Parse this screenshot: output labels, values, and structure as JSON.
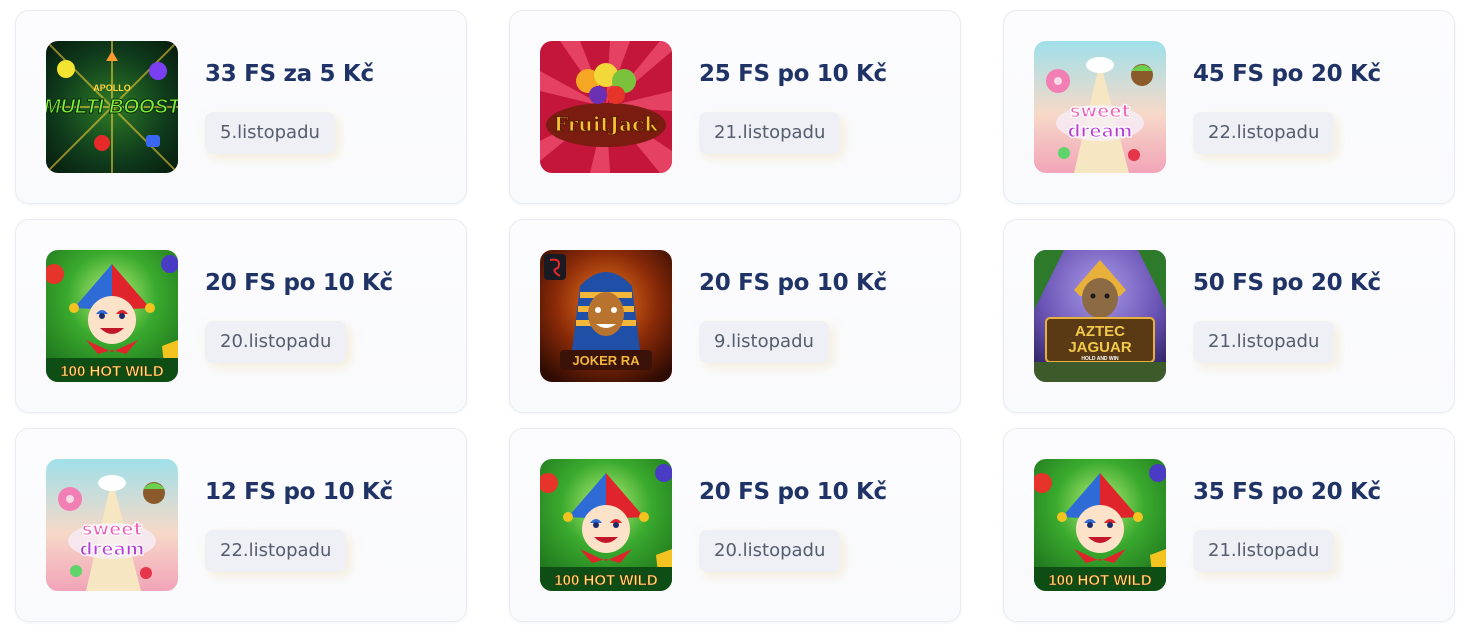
{
  "bonuses": [
    {
      "game": "multiboost",
      "offer": "33 FS za 5 Kč",
      "date": "5.listopadu",
      "logo_text": "MULTI BOOST",
      "logo_top": "APOLLO",
      "colors": {
        "bg": "#0f3b1c",
        "accent": "#7ff23a"
      }
    },
    {
      "game": "fruitjack",
      "offer": "25 FS po 10 Kč",
      "date": "21.listopadu",
      "logo_text": "FruitJack",
      "colors": {
        "bg": "#d92746",
        "accent": "#f5c531"
      }
    },
    {
      "game": "sweetdream",
      "offer": "45 FS po 20 Kč",
      "date": "22.listopadu",
      "logo_text": "sweet dream",
      "colors": {
        "bg": "#f4c6cf",
        "accent": "#e24fb8"
      }
    },
    {
      "game": "100hotwild",
      "offer": "20 FS po 10 Kč",
      "date": "20.listopadu",
      "logo_text": "100 HOT WILD",
      "colors": {
        "bg": "#2f9b2c",
        "accent": "#d8232b"
      }
    },
    {
      "game": "jokerra",
      "offer": "20 FS po 10 Kč",
      "date": "9.listopadu",
      "logo_text": "JOKER RA",
      "colors": {
        "bg": "#6b2207",
        "accent": "#f2b63a"
      }
    },
    {
      "game": "aztecjaguar",
      "offer": "50 FS po 20 Kč",
      "date": "21.listopadu",
      "logo_text": "AZTEC JAGUAR",
      "logo_sub": "HOLD AND WIN",
      "colors": {
        "bg": "#6b54b5",
        "accent": "#e7b13b"
      }
    },
    {
      "game": "sweetdream",
      "offer": "12 FS po 10 Kč",
      "date": "22.listopadu",
      "logo_text": "sweet dream",
      "colors": {
        "bg": "#f4c6cf",
        "accent": "#e24fb8"
      }
    },
    {
      "game": "100hotwild",
      "offer": "20 FS po 10 Kč",
      "date": "20.listopadu",
      "logo_text": "100 HOT WILD",
      "colors": {
        "bg": "#2f9b2c",
        "accent": "#d8232b"
      }
    },
    {
      "game": "100hotwild",
      "offer": "35 FS po 20 Kč",
      "date": "21.listopadu",
      "logo_text": "100 HOT WILD",
      "colors": {
        "bg": "#2f9b2c",
        "accent": "#d8232b"
      }
    }
  ],
  "colors": {
    "offer_text": "#1f3366",
    "date_text": "#555d6e",
    "date_bg": "#eef0f5",
    "card_border": "#e8ebf1"
  }
}
